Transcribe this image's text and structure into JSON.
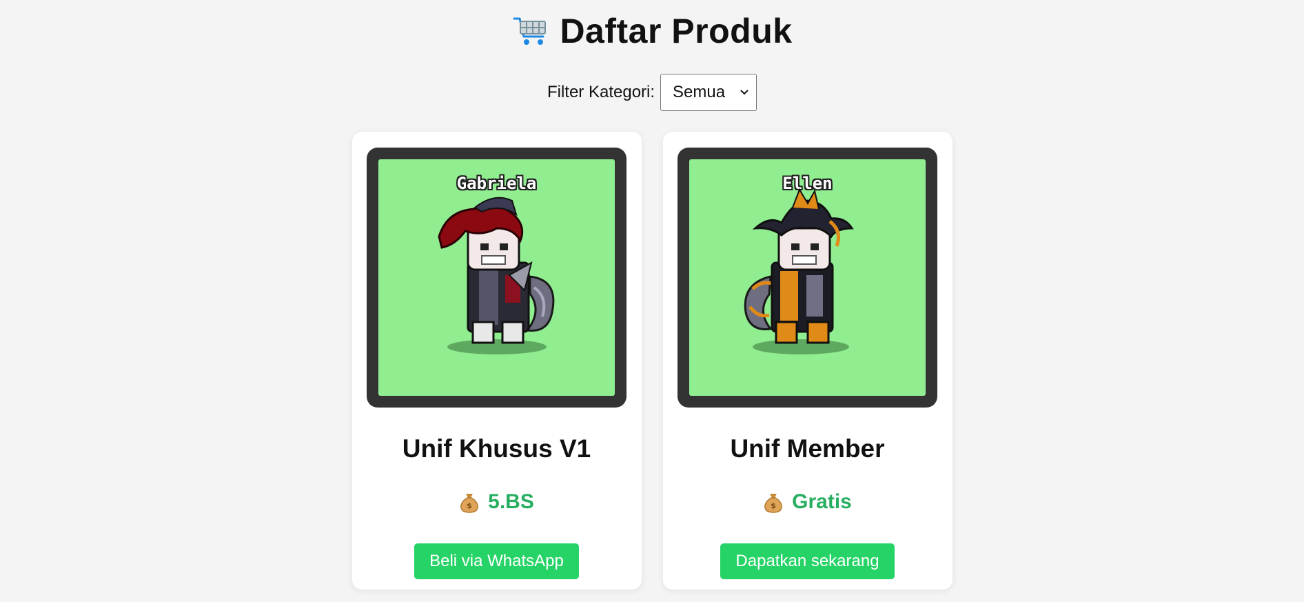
{
  "header": {
    "title": "Daftar Produk",
    "icon": "shopping-cart-icon"
  },
  "filter": {
    "label": "Filter Kategori:",
    "selected": "Semua"
  },
  "colors": {
    "accent_green": "#25d366",
    "price_green": "#27ae60",
    "preview_bg": "#90ee90",
    "frame": "#333333"
  },
  "products": [
    {
      "character_name": "Gabriela",
      "name": "Unif Khusus V1",
      "price_icon": "money-bag-icon",
      "price": "5.BS",
      "button_label": "Beli via WhatsApp"
    },
    {
      "character_name": "Ellen",
      "name": "Unif Member",
      "price_icon": "money-bag-icon",
      "price": "Gratis",
      "button_label": "Dapatkan sekarang"
    }
  ]
}
